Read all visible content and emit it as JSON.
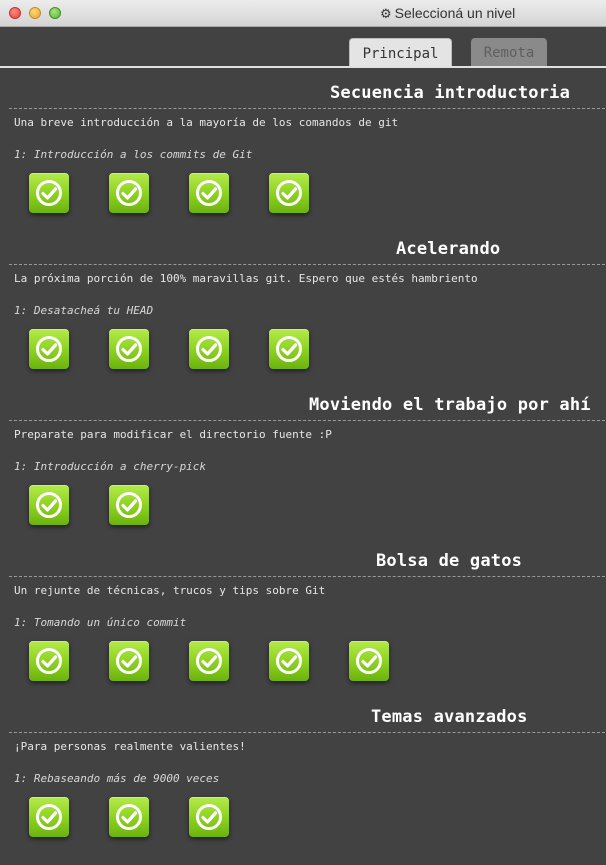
{
  "window": {
    "title": "Seleccioná un nivel",
    "title_icon": "gear-icon"
  },
  "tabs": [
    {
      "label": "Principal",
      "active": true
    },
    {
      "label": "Remota",
      "active": false
    }
  ],
  "sections": [
    {
      "title": "Secuencia introductoria",
      "description": "Una breve introducción a la mayoría de los comandos de git",
      "sequence": "1: Introducción a los commits de Git",
      "levels": [
        "completed",
        "completed",
        "completed",
        "completed"
      ]
    },
    {
      "title": "Acelerando",
      "description": "La próxima porción de 100% maravillas git. Espero que estés hambriento",
      "sequence": "1: Desatacheá tu HEAD",
      "levels": [
        "completed",
        "completed",
        "completed",
        "completed"
      ]
    },
    {
      "title": "Moviendo el trabajo por ahí",
      "description": "Preparate para modificar el directorio fuente :P",
      "sequence": "1: Introducción a cherry-pick",
      "levels": [
        "completed",
        "completed"
      ]
    },
    {
      "title": "Bolsa de gatos",
      "description": "Un rejunte de técnicas, trucos y tips sobre Git",
      "sequence": "1: Tomando un único commit",
      "levels": [
        "completed",
        "completed",
        "completed",
        "completed",
        "completed"
      ]
    },
    {
      "title": "Temas avanzados",
      "description": "¡Para personas realmente valientes!",
      "sequence": "1: Rebaseando más de 9000 veces",
      "levels": [
        "completed",
        "completed",
        "completed"
      ]
    }
  ],
  "colors": {
    "background": "#424242",
    "level_complete": "#8fd321",
    "title_text": "#ffffff"
  }
}
